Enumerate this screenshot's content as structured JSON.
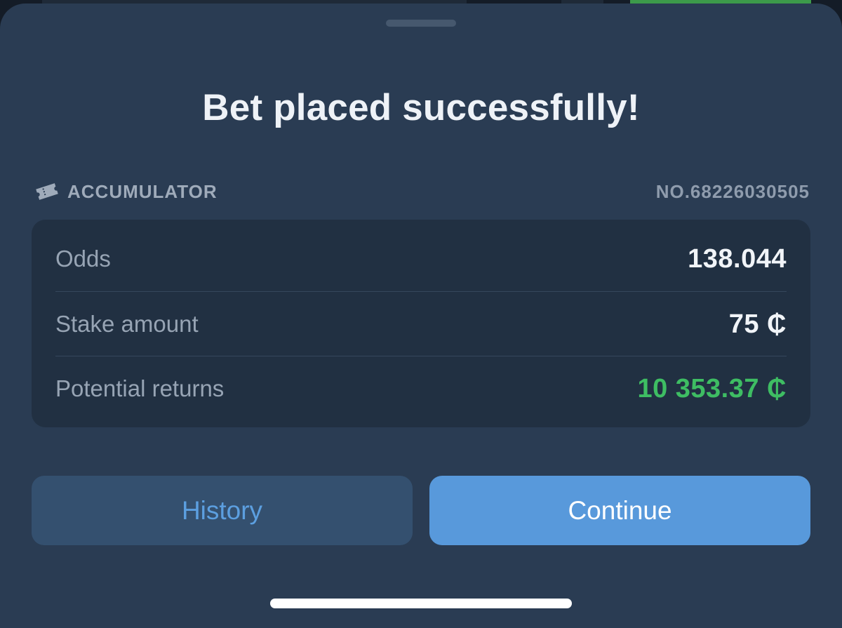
{
  "sheet": {
    "title": "Bet placed successfully!"
  },
  "bet": {
    "type_label": "ACCUMULATOR",
    "type_icon": "ticket-icon",
    "number": "NO.68226030505"
  },
  "summary": {
    "rows": [
      {
        "label": "Odds",
        "value": "138.044"
      },
      {
        "label": "Stake amount",
        "value": "75 ₵"
      },
      {
        "label": "Potential returns",
        "value": "10 353.37 ₵",
        "color": "#3ebd63"
      }
    ]
  },
  "actions": {
    "history_label": "History",
    "continue_label": "Continue"
  }
}
